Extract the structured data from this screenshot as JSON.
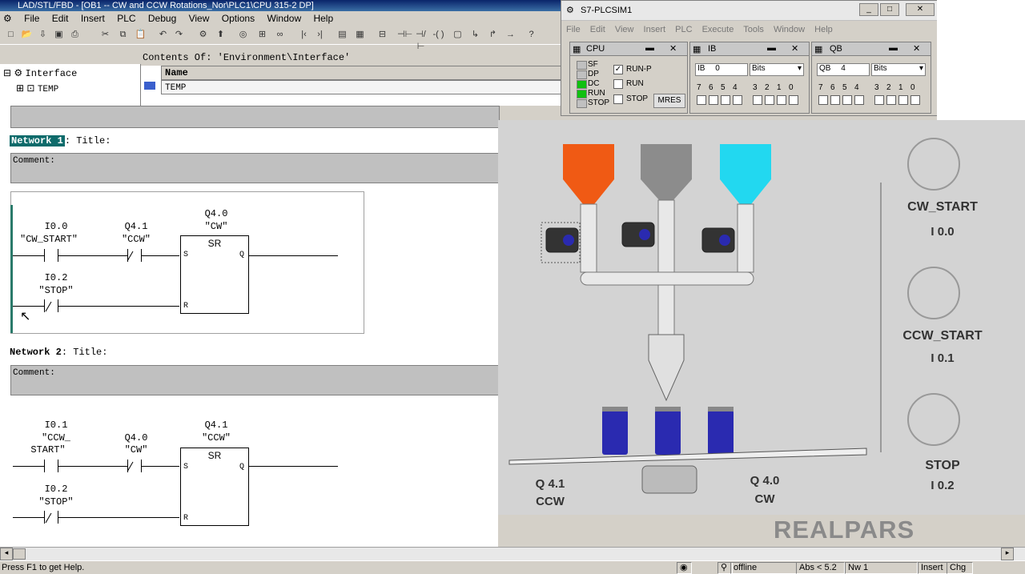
{
  "window": {
    "title": "LAD/STL/FBD - [OB1 -- CW and CCW Rotations_Nor\\PLC1\\CPU 315-2 DP]",
    "menu": [
      "File",
      "Edit",
      "Insert",
      "PLC",
      "Debug",
      "View",
      "Options",
      "Window",
      "Help"
    ]
  },
  "interface": {
    "contents_of": "Contents Of: 'Environment\\Interface'",
    "tree_root": "Interface",
    "tree_child": "TEMP",
    "column_name": "Name",
    "row_temp": "TEMP"
  },
  "networks": [
    {
      "label": "Network 1",
      "title": ": Title:",
      "comment": "Comment:",
      "contact1": {
        "address": "I0.0",
        "symbol": "\"CW_START\""
      },
      "contact2": {
        "address": "Q4.1",
        "symbol": "\"CCW\""
      },
      "contact3": {
        "address": "I0.2",
        "symbol": "\"STOP\""
      },
      "coil": {
        "address": "Q4.0",
        "symbol": "\"CW\"",
        "block": "SR",
        "s": "S",
        "r": "R",
        "q": "Q"
      }
    },
    {
      "label": "Network 2",
      "title": ": Title:",
      "comment": "Comment:",
      "contact1": {
        "address": "I0.1",
        "symbol_line1": "\"CCW_",
        "symbol_line2": "START\""
      },
      "contact2": {
        "address": "Q4.0",
        "symbol": "\"CW\""
      },
      "contact3": {
        "address": "I0.2",
        "symbol": "\"STOP\""
      },
      "coil": {
        "address": "Q4.1",
        "symbol": "\"CCW\"",
        "block": "SR",
        "s": "S",
        "r": "R",
        "q": "Q"
      }
    }
  ],
  "plcsim": {
    "title": "S7-PLCSIM1",
    "menu": [
      "File",
      "Edit",
      "View",
      "Insert",
      "PLC",
      "Execute",
      "Tools",
      "Window",
      "Help"
    ],
    "cpu": {
      "title": "CPU",
      "leds": [
        "SF",
        "DP",
        "DC",
        "RUN",
        "STOP"
      ],
      "led_on": [
        false,
        false,
        true,
        true,
        false
      ],
      "modes": [
        {
          "label": "RUN-P",
          "checked": true
        },
        {
          "label": "RUN",
          "checked": false
        },
        {
          "label": "STOP",
          "checked": false
        }
      ],
      "mres": "MRES"
    },
    "ib": {
      "title": "IB",
      "addr_label": "IB",
      "addr": "0",
      "format": "Bits",
      "bits": [
        "7",
        "6",
        "5",
        "4",
        "3",
        "2",
        "1",
        "0"
      ]
    },
    "qb": {
      "title": "QB",
      "addr_label": "QB",
      "addr": "4",
      "format": "Bits",
      "bits": [
        "7",
        "6",
        "5",
        "4",
        "3",
        "2",
        "1",
        "0"
      ]
    }
  },
  "process": {
    "buttons": [
      {
        "name": "CW_START",
        "addr": "I 0.0"
      },
      {
        "name": "CCW_START",
        "addr": "I 0.1"
      },
      {
        "name": "STOP",
        "addr": "I 0.2"
      }
    ],
    "motor_ccw": {
      "addr": "Q 4.1",
      "name": "CCW"
    },
    "motor_cw": {
      "addr": "Q 4.0",
      "name": "CW"
    },
    "hopper_colors": [
      "#f05a14",
      "#8c8c8c",
      "#22d8f0"
    ],
    "accent": "#2a2ab0"
  },
  "brand": {
    "logo_text": "REALPARS"
  },
  "status": {
    "help": "Press F1 to get Help.",
    "mode": "offline",
    "abs": "Abs < 5.2",
    "nw": "Nw 1",
    "insert": "Insert",
    "chg": "Chg"
  }
}
